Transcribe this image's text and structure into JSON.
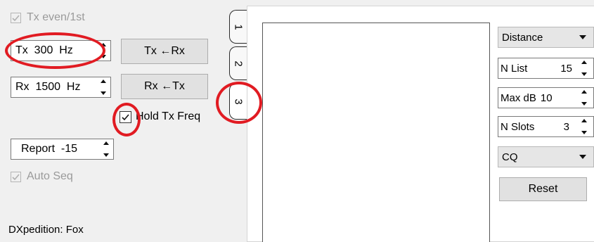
{
  "left_panel": {
    "tx_even_label": "Tx even/1st",
    "tx_freq_value": "Tx  300  Hz",
    "tx_from_rx_label": "Tx ←Rx",
    "rx_freq_value": "Rx  1500  Hz",
    "rx_from_tx_label": "Rx ←Tx",
    "hold_tx_freq_label": "Hold Tx Freq",
    "report_value": "Report  -15",
    "auto_seq_label": "Auto Seq",
    "dxpedition_label": "DXpedition: Fox"
  },
  "tabs": [
    {
      "label": "1"
    },
    {
      "label": "2"
    },
    {
      "label": "3"
    }
  ],
  "right_panel": {
    "sort_combo": "Distance",
    "n_list_label": "N List",
    "n_list_value": "15",
    "max_db_label": "Max dB",
    "max_db_value": "10",
    "n_slots_label": "N Slots",
    "n_slots_value": "3",
    "cq_combo": "CQ",
    "reset_label": "Reset"
  },
  "annotation_color": "#e11b22"
}
